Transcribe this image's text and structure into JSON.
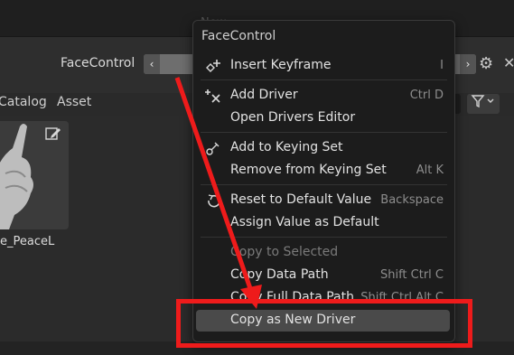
{
  "header": {
    "ghost_menu_title": "New",
    "prop_label": "FaceControl",
    "slider_left": "‹",
    "slider_right": "›",
    "gear_icon": "gear-icon",
    "close": "✕"
  },
  "tabs": [
    "Catalog",
    "Asset"
  ],
  "asset": {
    "label": "e_PeaceL"
  },
  "menu": {
    "title": "FaceControl",
    "items": [
      {
        "label": "Insert Keyframe",
        "shortcut": "I",
        "icon": "keyframe-add-icon"
      },
      {
        "label": "Add Driver",
        "shortcut": "Ctrl D",
        "icon": "driver-add-icon"
      },
      {
        "label": "Open Drivers Editor",
        "shortcut": ""
      },
      {
        "label": "Add to Keying Set",
        "shortcut": "",
        "icon": "keyingset-add-icon"
      },
      {
        "label": "Remove from Keying Set",
        "shortcut": "Alt K"
      },
      {
        "label": "Reset to Default Value",
        "shortcut": "Backspace",
        "icon": "reset-icon"
      },
      {
        "label": "Assign Value as Default",
        "shortcut": ""
      },
      {
        "label": "Copy to Selected",
        "shortcut": ""
      },
      {
        "label": "Copy Data Path",
        "shortcut": "Shift Ctrl C"
      },
      {
        "label": "Copy Full Data Path",
        "shortcut": "Shift Ctrl Alt C"
      },
      {
        "label": "Copy as New Driver",
        "shortcut": ""
      }
    ]
  },
  "colors": {
    "annotation": "#ee1b1b",
    "highlight": "#4a4a4a"
  }
}
